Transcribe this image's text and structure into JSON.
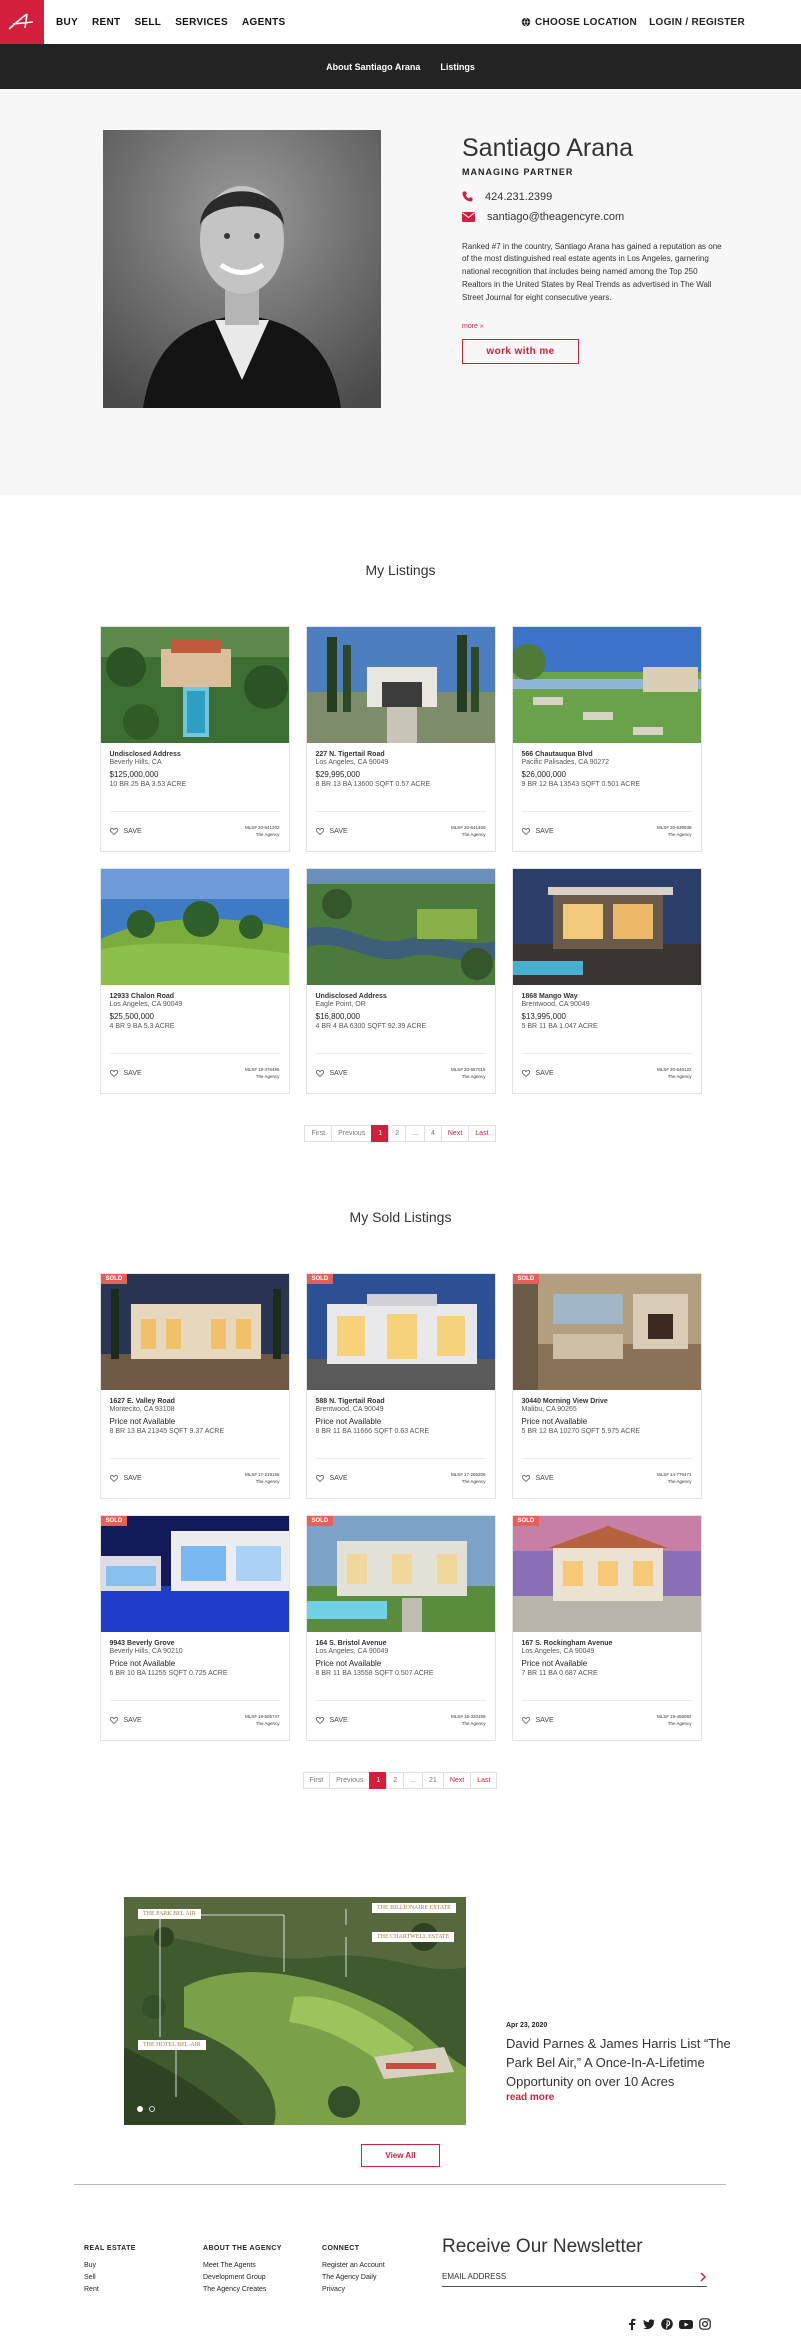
{
  "nav": {
    "items": [
      "BUY",
      "RENT",
      "SELL",
      "SERVICES",
      "AGENTS"
    ],
    "location": "CHOOSE LOCATION",
    "login": "LOGIN / REGISTER"
  },
  "subnav": {
    "about": "About Santiago Arana",
    "listings": "Listings"
  },
  "agent": {
    "name": "Santiago Arana",
    "title": "MANAGING PARTNER",
    "phone": "424.231.2399",
    "email": "santiago@theagencyre.com",
    "bio": "Ranked #7 in the country, Santiago Arana has gained a reputation as one of the most distinguished real estate agents in Los Angeles, garnering national recognition that includes being named among the Top 250 Realtors in the United States by Real Trends as advertised in The Wall Street Journal for eight consecutive years.",
    "more": "more »",
    "cta": "work with me"
  },
  "listings": {
    "title": "My Listings",
    "save_label": "SAVE",
    "cards": [
      {
        "address": "Undisclosed Address",
        "city": "Beverly Hills, CA",
        "price": "$125,000,000",
        "specs": "10 BR  25 BA  3.53 ACRE",
        "mls": "MLS# 20-641202",
        "brokerage": "The Agency"
      },
      {
        "address": "227 N. Tigertail Road",
        "city": "Los Angeles, CA  90049",
        "price": "$29,995,000",
        "specs": "8 BR  13 BA  13600 SQFT  0.57 ACRE",
        "mls": "MLS# 20-641450",
        "brokerage": "The Agency"
      },
      {
        "address": "566 Chautauqua Blvd",
        "city": "Pacific Palisades, CA  90272",
        "price": "$26,000,000",
        "specs": "9 BR  12 BA  13543 SQFT  0.501 ACRE",
        "mls": "MLS# 20-639938",
        "brokerage": "The Agency"
      },
      {
        "address": "12933 Chalon Road",
        "city": "Los Angeles, CA  90049",
        "price": "$25,500,000",
        "specs": "4 BR  9 BA  5.3 ACRE",
        "mls": "MLS# 19-476495",
        "brokerage": "The Agency"
      },
      {
        "address": "Undisclosed Address",
        "city": "Eagle Point, OR",
        "price": "$16,800,000",
        "specs": "4 BR  4 BA  6300 SQFT  92.39 ACRE",
        "mls": "MLS# 20-557015",
        "brokerage": "The Agency"
      },
      {
        "address": "1868 Mango Way",
        "city": "Brentwood, CA  90049",
        "price": "$13,995,000",
        "specs": "5 BR  11 BA  1.047 ACRE",
        "mls": "MLS# 20-649122",
        "brokerage": "The Agency"
      }
    ],
    "pager": [
      "First",
      "Previous",
      "1",
      "2",
      "...",
      "4",
      "Next",
      "Last"
    ]
  },
  "sold": {
    "title": "My Sold Listings",
    "badge": "SOLD",
    "save_label": "SAVE",
    "cards": [
      {
        "address": "1627 E. Valley Road",
        "city": "Montecito, CA  93108",
        "price": "Price not Available",
        "specs": "8 BR  13 BA  21345 SQFT  9.37 ACRE",
        "mls": "MLS# 17-219156",
        "brokerage": "The Agency"
      },
      {
        "address": "588 N. Tigertail Road",
        "city": "Brentwood, CA  90049",
        "price": "Price not Available",
        "specs": "8 BR  11 BA  11666 SQFT  0.63 ACRE",
        "mls": "MLS# 17-265206",
        "brokerage": "The Agency"
      },
      {
        "address": "30440 Morning View Drive",
        "city": "Malibu, CA  90265",
        "price": "Price not Available",
        "specs": "5 BR  12 BA  10270 SQFT  5.975 ACRE",
        "mls": "MLS# 14-776471",
        "brokerage": "The Agency"
      },
      {
        "address": "9943 Beverly Grove",
        "city": "Beverly Hills, CA  90210",
        "price": "Price not Available",
        "specs": "6 BR  10 BA  11255 SQFT  0.725 ACRE",
        "mls": "MLS# 19-505747",
        "brokerage": "The Agency"
      },
      {
        "address": "164 S. Bristol Avenue",
        "city": "Los Angeles, CA  90049",
        "price": "Price not Available",
        "specs": "8 BR  11 BA  13558 SQFT  0.507 ACRE",
        "mls": "MLS# 18-320199",
        "brokerage": "The Agency"
      },
      {
        "address": "167 S. Rockingham Avenue",
        "city": "Los Angeles, CA  90049",
        "price": "Price not Available",
        "specs": "7 BR  11 BA  0.687 ACRE",
        "mls": "MLS# 19-458092",
        "brokerage": "The Agency"
      }
    ],
    "pager": [
      "First",
      "Previous",
      "1",
      "2",
      "...",
      "21",
      "Next",
      "Last"
    ]
  },
  "press": {
    "date": "Apr 23, 2020",
    "headline": "David Parnes & James Harris List “The Park Bel Air,” A Once-In-A-Lifetime Opportunity on over 10 Acres",
    "read_more": "read more",
    "view_all": "View All",
    "map_labels": [
      "THE PARK BEL AIR",
      "THE BILLIONAIRE ESTATE",
      "THE CHARTWELL ESTATE",
      "THE HOTEL BEL-AIR"
    ]
  },
  "footer": {
    "real_estate": {
      "heading": "REAL ESTATE",
      "links": [
        "Buy",
        "Sell",
        "Rent"
      ]
    },
    "about": {
      "heading": "ABOUT THE AGENCY",
      "links": [
        "Meet The Agents",
        "Development Group",
        "The Agency Creates"
      ]
    },
    "connect": {
      "heading": "CONNECT",
      "links": [
        "Register an Account",
        "The Agency Daily",
        "Privacy"
      ]
    },
    "newsletter": {
      "title": "Receive Our Newsletter",
      "placeholder": "EMAIL ADDRESS"
    }
  },
  "colors": {
    "brand": "#d21f3c",
    "dark": "#232323",
    "sold": "#e4605a"
  },
  "icons": [
    "logo-icon",
    "globe-icon",
    "phone-icon",
    "mail-icon",
    "heart-icon",
    "arrow-right-icon",
    "facebook-icon",
    "twitter-icon",
    "pinterest-icon",
    "youtube-icon",
    "instagram-icon"
  ]
}
